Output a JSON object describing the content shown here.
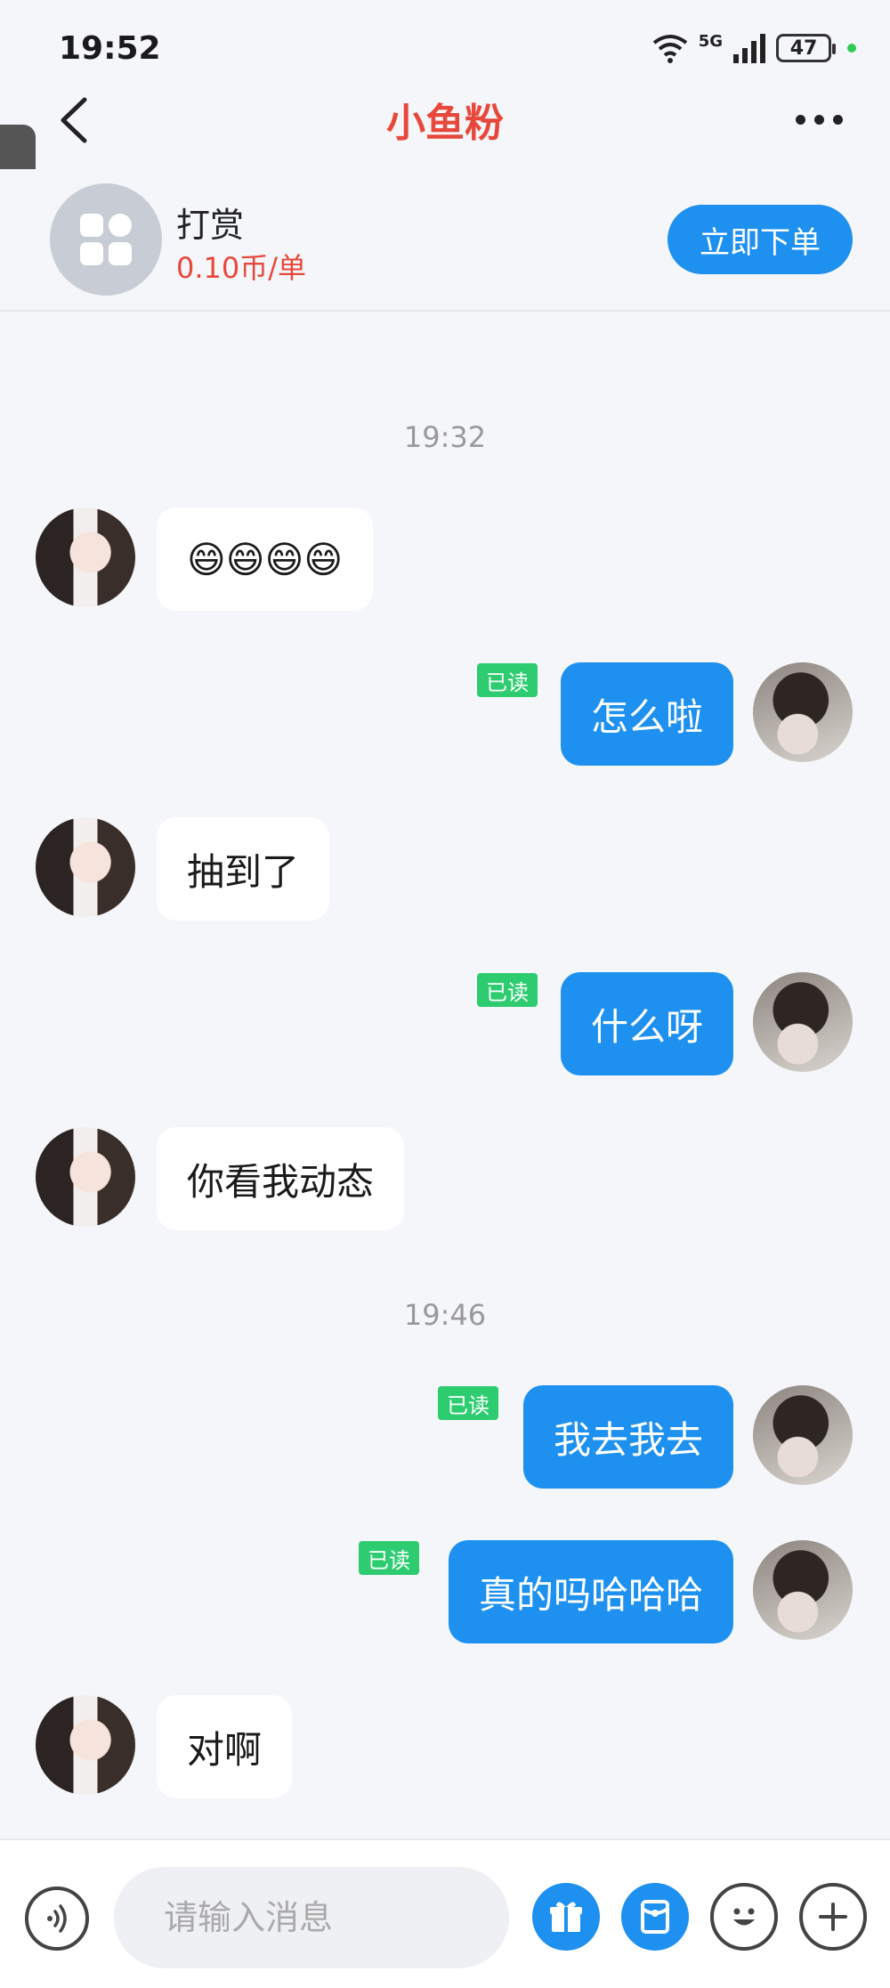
{
  "status_bar": {
    "time": "19:52",
    "network": "5G",
    "battery": "47"
  },
  "nav": {
    "title": "小鱼粉"
  },
  "service": {
    "name": "打赏",
    "price": "0.10币/单",
    "order_label": "立即下单"
  },
  "conversation": {
    "timestamps": [
      "19:32",
      "19:46"
    ],
    "read_label": "已读",
    "messages": [
      {
        "side": "in",
        "text": "😄😄😄😄"
      },
      {
        "side": "out",
        "text": "怎么啦"
      },
      {
        "side": "in",
        "text": "抽到了"
      },
      {
        "side": "out",
        "text": "什么呀"
      },
      {
        "side": "in",
        "text": "你看我动态"
      },
      {
        "side": "out",
        "text": "我去我去"
      },
      {
        "side": "out",
        "text": "真的吗哈哈哈"
      },
      {
        "side": "in",
        "text": "对啊"
      }
    ]
  },
  "input": {
    "placeholder": "请输入消息"
  },
  "colors": {
    "accent": "#1e90f0",
    "title": "#e8483b",
    "read": "#2ecc71",
    "background": "#f4f6f9"
  },
  "icons": [
    "back-icon",
    "more-icon",
    "wifi-icon",
    "signal-icon",
    "battery-icon",
    "voice-icon",
    "gift-icon",
    "red-packet-icon",
    "emoji-icon",
    "plus-icon"
  ]
}
